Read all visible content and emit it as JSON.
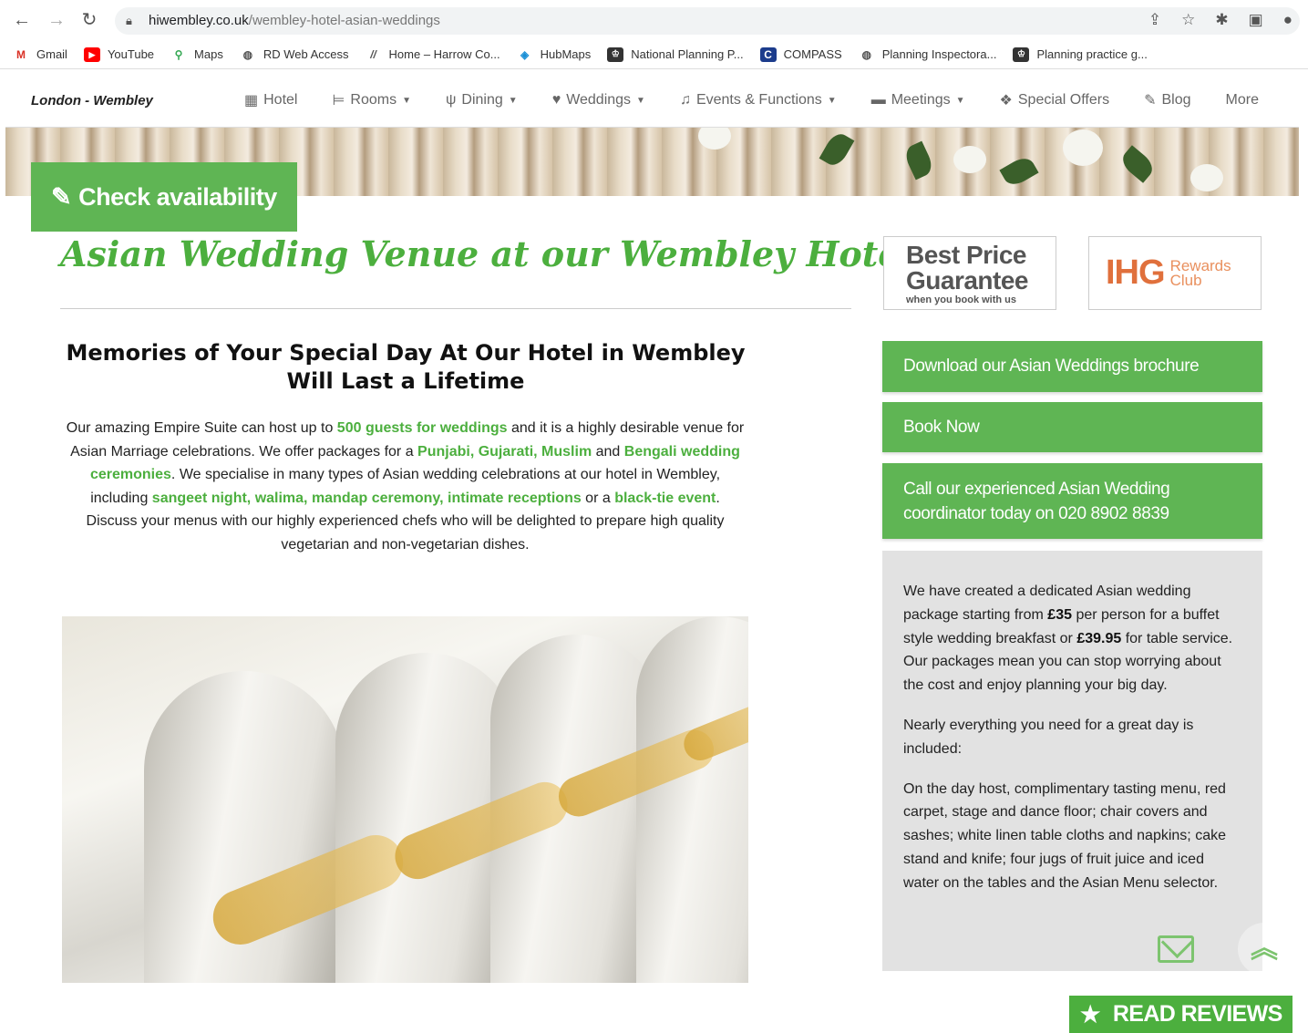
{
  "browser": {
    "url_domain": "hiwembley.co.uk",
    "url_path": "/wembley-hotel-asian-weddings"
  },
  "bookmarks": [
    {
      "label": "Gmail",
      "icon": "gmail-icon"
    },
    {
      "label": "YouTube",
      "icon": "youtube-icon"
    },
    {
      "label": "Maps",
      "icon": "maps-icon"
    },
    {
      "label": "RD Web Access",
      "icon": "globe-icon"
    },
    {
      "label": "Home – Harrow Co...",
      "icon": "harrow-icon"
    },
    {
      "label": "HubMaps",
      "icon": "hubmaps-icon"
    },
    {
      "label": "National Planning P...",
      "icon": "crown-icon"
    },
    {
      "label": "COMPASS",
      "icon": "compass-icon"
    },
    {
      "label": "Planning Inspectora...",
      "icon": "globe-icon"
    },
    {
      "label": "Planning practice g...",
      "icon": "crown-icon"
    }
  ],
  "site_nav": {
    "brand": "London - Wembley",
    "items": [
      {
        "label": "Hotel",
        "icon": "building-icon",
        "dropdown": false
      },
      {
        "label": "Rooms",
        "icon": "bed-icon",
        "dropdown": true
      },
      {
        "label": "Dining",
        "icon": "cutlery-icon",
        "dropdown": true
      },
      {
        "label": "Weddings",
        "icon": "heart-icon",
        "dropdown": true
      },
      {
        "label": "Events & Functions",
        "icon": "music-icon",
        "dropdown": true
      },
      {
        "label": "Meetings",
        "icon": "briefcase-icon",
        "dropdown": true
      },
      {
        "label": "Special Offers",
        "icon": "gift-icon",
        "dropdown": false
      },
      {
        "label": "Blog",
        "icon": "pencil-icon",
        "dropdown": false
      },
      {
        "label": "More",
        "icon": "",
        "dropdown": false
      }
    ]
  },
  "check_availability": "Check availability",
  "page_title": "Asian Wedding Venue at our Wembley Hotel",
  "badges": {
    "best_price_line1": "Best Price",
    "best_price_line2": "Guarantee",
    "best_price_sub": "when you book with us",
    "ihg_logo": "IHG",
    "ihg_rewards": "Rewards",
    "ihg_club": "Club"
  },
  "sub_heading_line1": "Memories of Your Special Day At Our Hotel in Wembley",
  "sub_heading_line2": "Will Last a Lifetime",
  "intro": {
    "t1": "Our amazing Empire Suite can host up to ",
    "g1": "500 guests for weddings",
    "t2": " and it is a highly desirable venue for Asian Marriage celebrations.  We offer packages for a ",
    "g2": "Punjabi, Gujarati, Muslim",
    "t3": " and ",
    "g3": "Bengali wedding ceremonies",
    "t4": ".  We specialise in many types of Asian wedding celebrations at our hotel in Wembley, including ",
    "g4": "sangeet night, walima, mandap ceremony, intimate receptions",
    "t5": " or a ",
    "g5": "black-tie event",
    "t6": ".  Discuss your menus with our highly experienced chefs who will be delighted to prepare high quality vegetarian and non-vegetarian dishes."
  },
  "sidebar": {
    "brochure_btn": "Download our Asian Weddings brochure",
    "book_btn": "Book Now",
    "call_btn_line1": "Call our experienced Asian Wedding",
    "call_btn_line2": "coordinator today on 020 8902 8839",
    "p1_a": "We have created a dedicated Asian wedding package starting from ",
    "p1_price1": "£35",
    "p1_b": " per person for a buffet style wedding breakfast or ",
    "p1_price2": "£39.95",
    "p1_c": " for table service. Our packages mean you can stop worrying about the cost and enjoy planning your big day.",
    "p2": "Nearly everything you need for a great day is included:",
    "p3": "On the day host, complimentary tasting menu, red carpet, stage and dance floor; chair covers and sashes; white linen table cloths and napkins; cake stand and knife; four jugs of fruit juice and iced water on the tables and the Asian Menu selector."
  },
  "read_reviews": "READ REVIEWS",
  "colors": {
    "accent_green": "#5fb554",
    "title_green": "#4caf3e",
    "ihg_orange": "#e0703c",
    "panel_grey": "#e2e2e2"
  }
}
